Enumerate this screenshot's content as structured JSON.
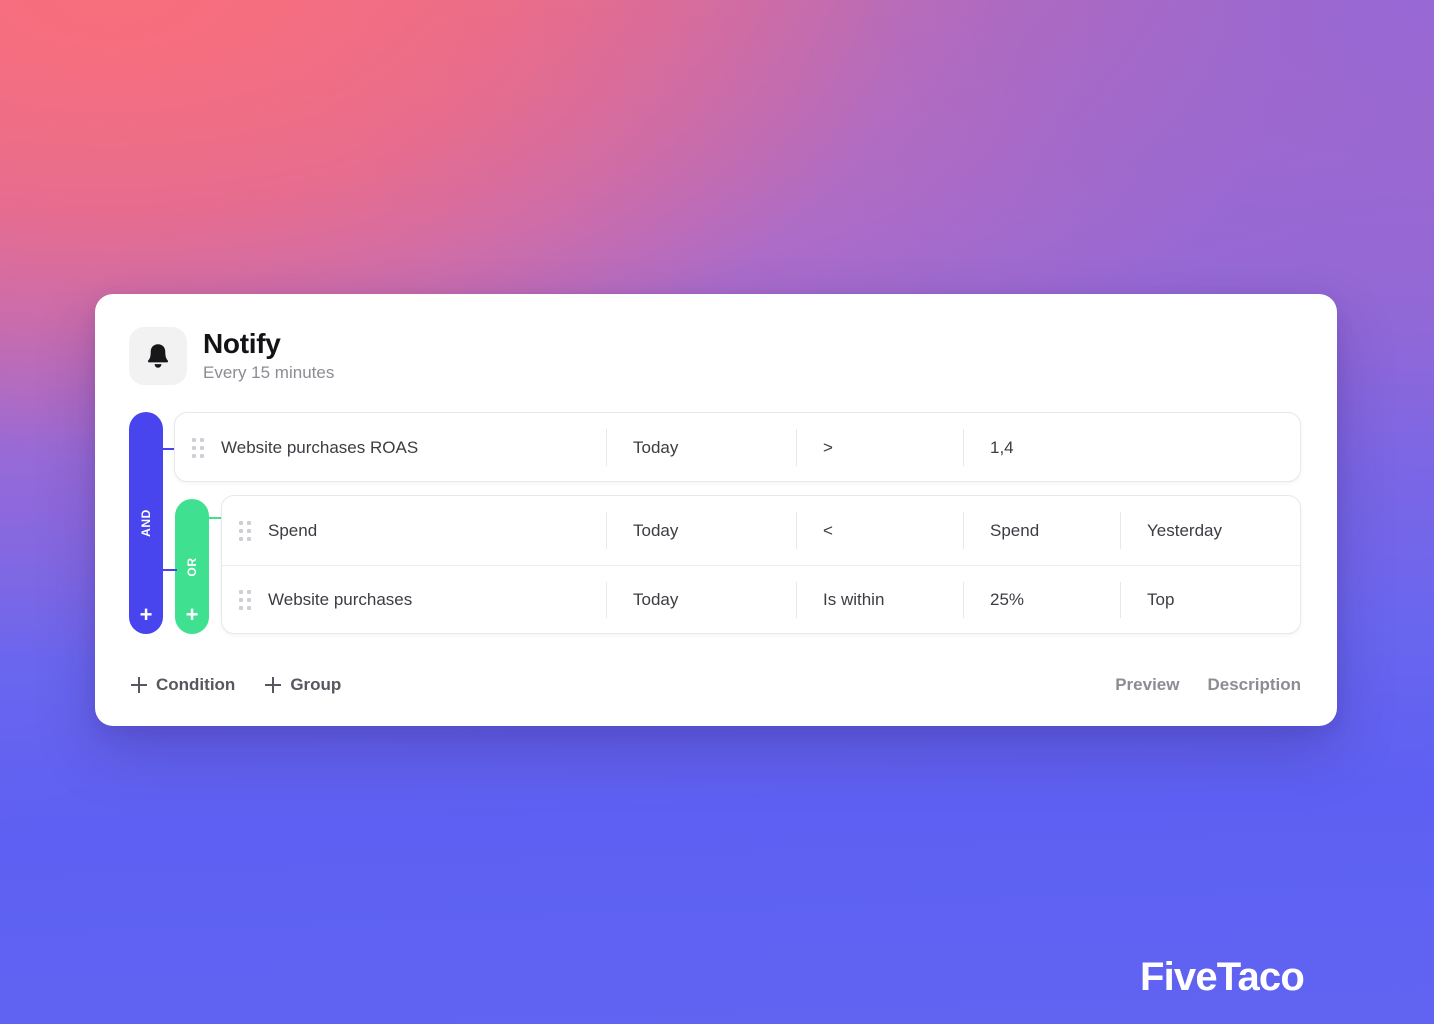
{
  "brand": {
    "watermark": "FiveTaco",
    "accent_blue": "#4845ef",
    "accent_green": "#3fe08f"
  },
  "card": {
    "icon": "bell-icon",
    "title": "Notify",
    "subtitle": "Every 15 minutes"
  },
  "rule_builder": {
    "root_operator": "AND",
    "group_operator": "OR",
    "add_glyph": "+",
    "root_conditions": [
      {
        "metric": "Website purchases ROAS",
        "range": "Today",
        "operator": ">",
        "value": "1,4"
      }
    ],
    "group_conditions": [
      {
        "metric": "Spend",
        "range": "Today",
        "operator": "<",
        "value": "Spend",
        "extra": "Yesterday"
      },
      {
        "metric": "Website purchases",
        "range": "Today",
        "operator": "Is within",
        "value": "25%",
        "extra": "Top"
      }
    ]
  },
  "footer": {
    "add_condition_label": "Condition",
    "add_group_label": "Group",
    "preview_label": "Preview",
    "description_label": "Description"
  }
}
